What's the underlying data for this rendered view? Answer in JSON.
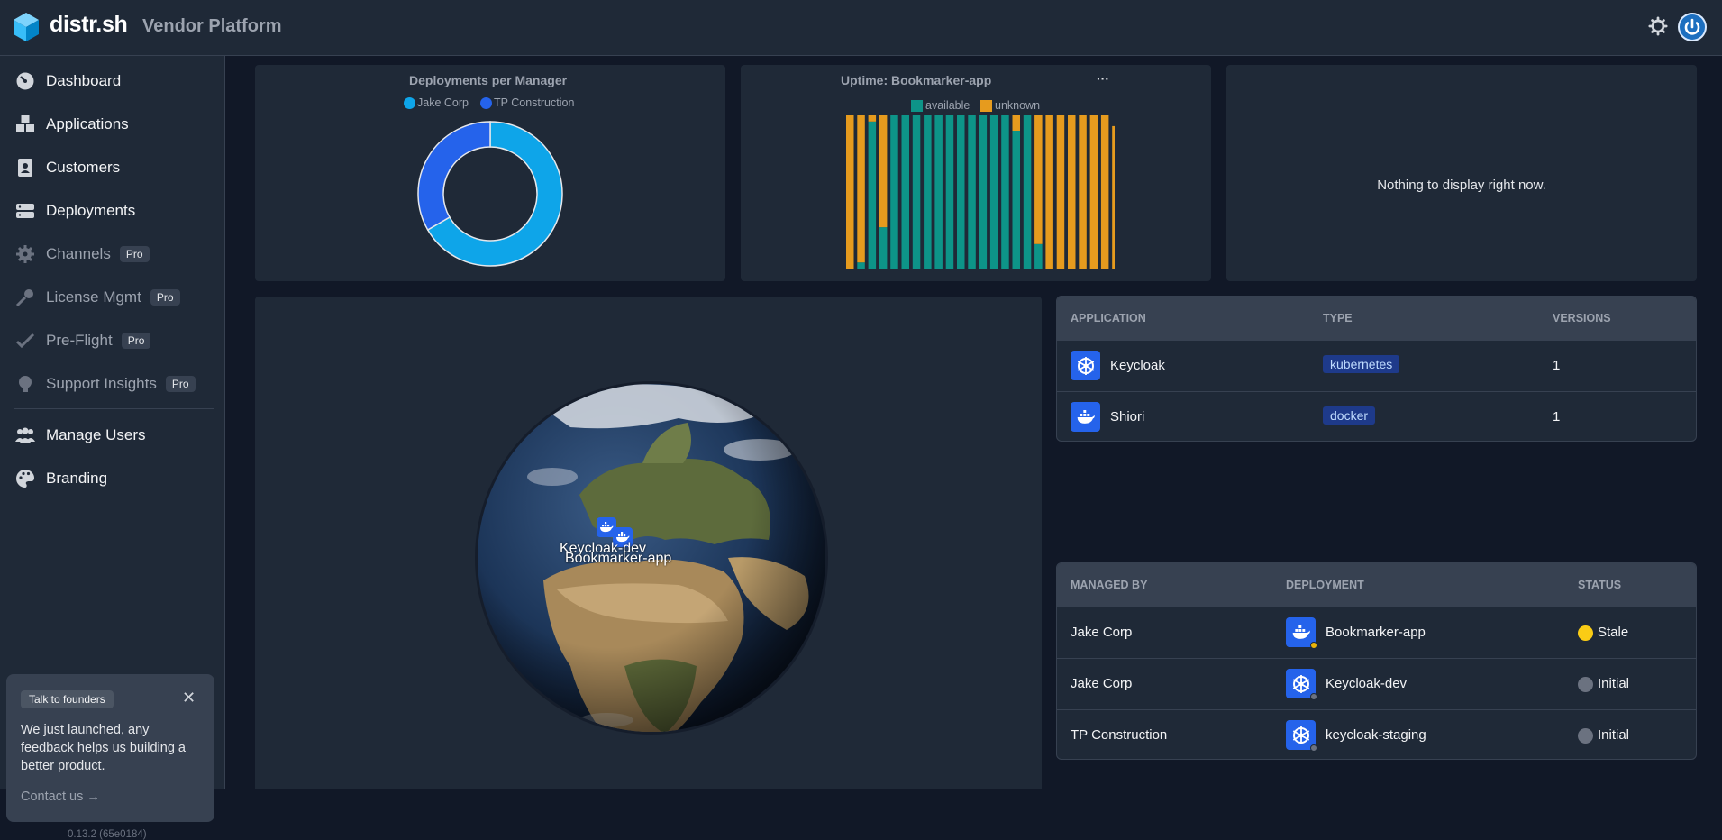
{
  "header": {
    "brand": "distr.sh",
    "subtitle": "Vendor Platform"
  },
  "sidebar": {
    "items": [
      {
        "label": "Dashboard",
        "icon": "dashboard-icon",
        "pro": false
      },
      {
        "label": "Applications",
        "icon": "applications-icon",
        "pro": false
      },
      {
        "label": "Customers",
        "icon": "customers-icon",
        "pro": false
      },
      {
        "label": "Deployments",
        "icon": "deployments-icon",
        "pro": false
      },
      {
        "label": "Channels",
        "icon": "gear-icon",
        "pro": true
      },
      {
        "label": "License Mgmt",
        "icon": "key-icon",
        "pro": true
      },
      {
        "label": "Pre-Flight",
        "icon": "checks-icon",
        "pro": true
      },
      {
        "label": "Support Insights",
        "icon": "lightbulb-icon",
        "pro": true
      },
      {
        "label": "Manage Users",
        "icon": "users-icon",
        "pro": false
      },
      {
        "label": "Branding",
        "icon": "palette-icon",
        "pro": false
      }
    ],
    "pro_label": "Pro",
    "promo": {
      "tag": "Talk to founders",
      "text": "We just launched, any feedback helps us building a better product.",
      "link": "Contact us"
    },
    "version": "0.13.2 (65e0184)"
  },
  "deployments_chart": {
    "title": "Deployments per Manager",
    "legend": [
      "Jake Corp",
      "TP Construction"
    ]
  },
  "uptime_chart": {
    "title": "Uptime: Bookmarker-app",
    "legend": [
      "available",
      "unknown"
    ]
  },
  "empty_panel": {
    "message": "Nothing to display right now."
  },
  "chart_data": [
    {
      "type": "pie",
      "title": "Deployments per Manager",
      "series": [
        {
          "name": "Jake Corp",
          "value": 2,
          "color": "#0ea5e9"
        },
        {
          "name": "TP Construction",
          "value": 1,
          "color": "#2563eb"
        }
      ]
    },
    {
      "type": "bar",
      "title": "Uptime: Bookmarker-app",
      "stacked": true,
      "colors": {
        "available": "#0d9488",
        "unknown": "#e69b1e"
      },
      "bars": [
        {
          "available": 0,
          "unknown": 1
        },
        {
          "available": 0.04,
          "unknown": 0.96
        },
        {
          "available": 0.96,
          "unknown": 0.04
        },
        {
          "available": 0.27,
          "unknown": 0.73
        },
        {
          "available": 1,
          "unknown": 0
        },
        {
          "available": 1,
          "unknown": 0
        },
        {
          "available": 1,
          "unknown": 0
        },
        {
          "available": 1,
          "unknown": 0
        },
        {
          "available": 1,
          "unknown": 0
        },
        {
          "available": 1,
          "unknown": 0
        },
        {
          "available": 1,
          "unknown": 0
        },
        {
          "available": 1,
          "unknown": 0
        },
        {
          "available": 1,
          "unknown": 0
        },
        {
          "available": 1,
          "unknown": 0
        },
        {
          "available": 1,
          "unknown": 0
        },
        {
          "available": 0.9,
          "unknown": 0.1
        },
        {
          "available": 1,
          "unknown": 0
        },
        {
          "available": 0.16,
          "unknown": 0.84
        },
        {
          "available": 0,
          "unknown": 1
        },
        {
          "available": 0,
          "unknown": 1
        },
        {
          "available": 0,
          "unknown": 1
        },
        {
          "available": 0,
          "unknown": 1
        },
        {
          "available": 0,
          "unknown": 1
        },
        {
          "available": 0,
          "unknown": 1
        },
        {
          "available": 0,
          "unknown": 0.93
        }
      ]
    }
  ],
  "globe": {
    "labels": [
      "Keycloak-dev",
      "Bookmarker-app"
    ]
  },
  "applications": {
    "headers": [
      "APPLICATION",
      "TYPE",
      "VERSIONS"
    ],
    "rows": [
      {
        "name": "Keycloak",
        "type": "kubernetes",
        "versions": "1",
        "icon": "kubernetes-icon"
      },
      {
        "name": "Shiori",
        "type": "docker",
        "versions": "1",
        "icon": "docker-icon"
      }
    ]
  },
  "deployments": {
    "headers": [
      "MANAGED BY",
      "DEPLOYMENT",
      "STATUS"
    ],
    "rows": [
      {
        "manager": "Jake Corp",
        "deployment": "Bookmarker-app",
        "status": "Stale",
        "status_color": "#facc15",
        "icon": "docker-icon"
      },
      {
        "manager": "Jake Corp",
        "deployment": "Keycloak-dev",
        "status": "Initial",
        "status_color": "#6b7280",
        "icon": "kubernetes-icon"
      },
      {
        "manager": "TP Construction",
        "deployment": "keycloak-staging",
        "status": "Initial",
        "status_color": "#6b7280",
        "icon": "kubernetes-icon"
      }
    ]
  }
}
